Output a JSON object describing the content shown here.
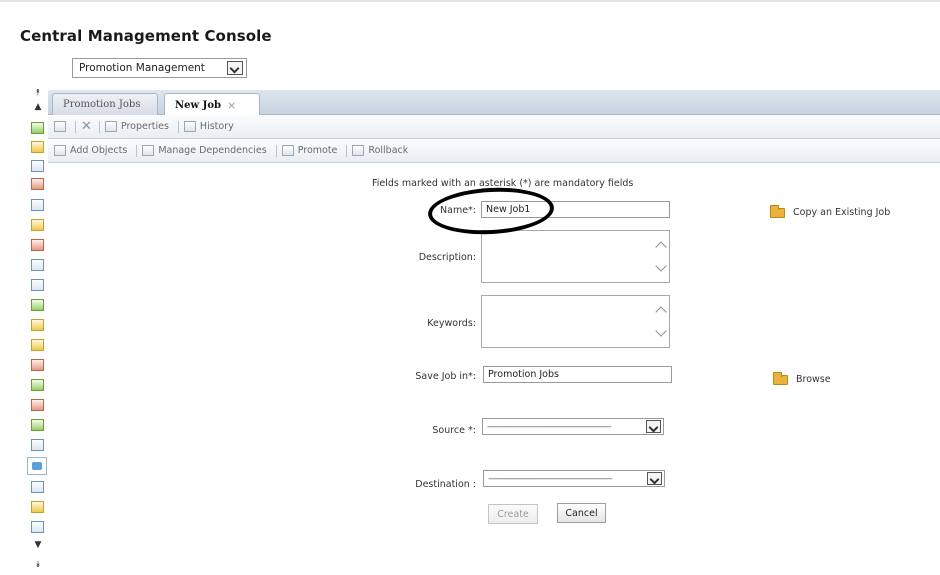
{
  "app": {
    "title": "Central Management Console"
  },
  "app_selector": {
    "value": "Promotion Management"
  },
  "tabs": [
    {
      "label": "Promotion Jobs",
      "active": false
    },
    {
      "label": "New Job",
      "active": true,
      "close": "×"
    }
  ],
  "toolbar1": {
    "properties": "Properties",
    "history": "History"
  },
  "toolbar2": {
    "add_objects": "Add Objects",
    "manage_dependencies": "Manage Dependencies",
    "promote": "Promote",
    "rollback": "Rollback"
  },
  "form": {
    "note": "Fields marked with an asterisk (*) are mandatory fields",
    "name_label": "Name*:",
    "name_value": "New Job1",
    "copy_existing": "Copy an Existing Job",
    "description_label": "Description:",
    "keywords_label": "Keywords:",
    "save_in_label": "Save Job in*:",
    "save_in_value": "Promotion Jobs",
    "browse": "Browse",
    "source_label": "Source *:",
    "source_value": "-------------------------------------------------------",
    "destination_label": "Destination :",
    "destination_value": "-------------------------------------------------------",
    "create": "Create",
    "cancel": "Cancel"
  },
  "colors": {
    "tab_bar": "#c7d3df",
    "folder": "#e9b33c",
    "annotation": "#000000"
  }
}
